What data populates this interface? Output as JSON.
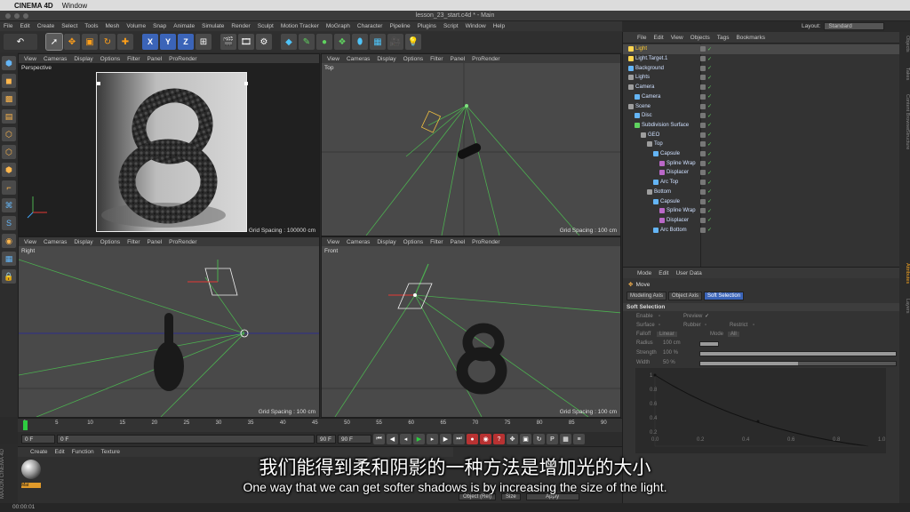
{
  "macbar": {
    "app": "CINEMA 4D",
    "menu": "Window"
  },
  "window_title": "lesson_23_start.c4d * - Main",
  "app_menu": [
    "File",
    "Edit",
    "Create",
    "Select",
    "Tools",
    "Mesh",
    "Volume",
    "Snap",
    "Animate",
    "Simulate",
    "Render",
    "Sculpt",
    "Motion Tracker",
    "MoGraph",
    "Character",
    "Pipeline",
    "Plugins",
    "Script",
    "Window",
    "Help"
  ],
  "layout": {
    "label": "Layout:",
    "value": "Standard"
  },
  "viewport_menu": [
    "View",
    "Cameras",
    "Display",
    "Options",
    "Filter",
    "Panel",
    "ProRender"
  ],
  "viewports": {
    "perspective": {
      "label": "Perspective",
      "grid": "Grid Spacing : 100000 cm"
    },
    "top": {
      "label": "Top",
      "grid": "Grid Spacing : 100 cm"
    },
    "right": {
      "label": "Right",
      "grid": "Grid Spacing : 100 cm"
    },
    "front": {
      "label": "Front",
      "grid": "Grid Spacing : 100 cm"
    }
  },
  "toolbar": {
    "axis_x": "X",
    "axis_y": "Y",
    "axis_z": "Z"
  },
  "timeline": {
    "ticks": [
      "0",
      "5",
      "10",
      "15",
      "20",
      "25",
      "30",
      "35",
      "40",
      "45",
      "50",
      "55",
      "60",
      "65",
      "70",
      "75",
      "80",
      "85",
      "90"
    ],
    "current_frame": "0 F",
    "start": "0 F",
    "min": "0 F",
    "max_slider": "90 F",
    "end": "90 F"
  },
  "material_manager": {
    "menu": [
      "Create",
      "Edit",
      "Function",
      "Texture"
    ],
    "material_label": "Mat"
  },
  "maxon": "MAXON CINEMA 4D",
  "coord_manager": {
    "sel1": "Object (Rel)",
    "sel2": "Size",
    "apply": "Apply"
  },
  "statusbar": "00:00:01",
  "object_manager": {
    "menu": [
      "File",
      "Edit",
      "View",
      "Objects",
      "Tags",
      "Bookmarks"
    ],
    "rows": [
      {
        "name": "Light",
        "indent": 0,
        "color": "#ffd54f",
        "selected": true
      },
      {
        "name": "Light.Target.1",
        "indent": 0,
        "color": "#ffd54f",
        "selected": false
      },
      {
        "name": "Background",
        "indent": 0,
        "color": "#64b5f6",
        "selected": false
      },
      {
        "name": "Lights",
        "indent": 0,
        "color": "#9e9e9e",
        "selected": false
      },
      {
        "name": "Camera",
        "indent": 0,
        "color": "#9e9e9e",
        "selected": false
      },
      {
        "name": "Camera",
        "indent": 1,
        "color": "#64b5f6",
        "selected": false
      },
      {
        "name": "Scene",
        "indent": 0,
        "color": "#9e9e9e",
        "selected": false
      },
      {
        "name": "Disc",
        "indent": 1,
        "color": "#64b5f6",
        "selected": false
      },
      {
        "name": "Subdivision Surface",
        "indent": 1,
        "color": "#5fd35f",
        "selected": false
      },
      {
        "name": "GEO",
        "indent": 2,
        "color": "#9e9e9e",
        "selected": false
      },
      {
        "name": "Top",
        "indent": 3,
        "color": "#9e9e9e",
        "selected": false
      },
      {
        "name": "Capsule",
        "indent": 4,
        "color": "#64b5f6",
        "selected": false
      },
      {
        "name": "Spline Wrap",
        "indent": 5,
        "color": "#ba68c8",
        "selected": false
      },
      {
        "name": "Displacer",
        "indent": 5,
        "color": "#ba68c8",
        "selected": false
      },
      {
        "name": "Arc Top",
        "indent": 4,
        "color": "#64b5f6",
        "selected": false
      },
      {
        "name": "Bottom",
        "indent": 3,
        "color": "#9e9e9e",
        "selected": false
      },
      {
        "name": "Capsule",
        "indent": 4,
        "color": "#64b5f6",
        "selected": false
      },
      {
        "name": "Spline Wrap",
        "indent": 5,
        "color": "#ba68c8",
        "selected": false
      },
      {
        "name": "Displacer",
        "indent": 5,
        "color": "#ba68c8",
        "selected": false
      },
      {
        "name": "Arc Bottom",
        "indent": 4,
        "color": "#64b5f6",
        "selected": false
      }
    ]
  },
  "attribute_manager": {
    "menu": [
      "Mode",
      "Edit",
      "User Data"
    ],
    "mode": "Move",
    "tabs": [
      "Modeling Axis",
      "Object Axis",
      "Soft Selection"
    ],
    "section": "Soft Selection",
    "fields": {
      "enable": "Enable",
      "preview": "Preview",
      "surface": "Surface",
      "rubber": "Rubber",
      "restrict": "Restrict",
      "falloff": "Falloff",
      "falloff_val": "Linear",
      "mode": "Mode",
      "mode_val": "All",
      "radius": "Radius",
      "radius_val": "100 cm",
      "strength": "Strength",
      "strength_val": "100 %",
      "width": "Width",
      "width_val": "50 %"
    },
    "curve_y": [
      "1",
      "0.8",
      "0.6",
      "0.4",
      "0.2"
    ],
    "curve_x": [
      "0.0",
      "0.2",
      "0.4",
      "0.6",
      "0.8",
      "1.0"
    ]
  },
  "edge_tabs": [
    "Objects",
    "Takes",
    "Content Browser",
    "Structure",
    "Attributes",
    "Layers"
  ],
  "subtitles": {
    "cn": "我们能得到柔和阴影的一种方法是增加光的大小",
    "en": "One way that we can get softer shadows is by increasing the size of the light."
  }
}
